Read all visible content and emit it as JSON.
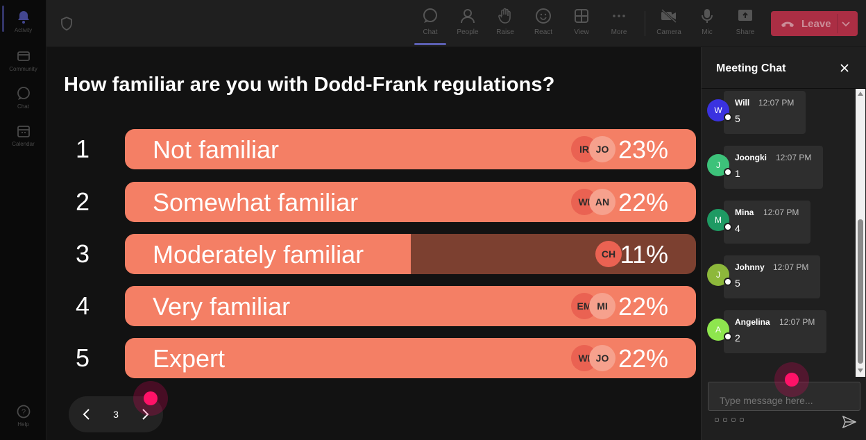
{
  "rail": {
    "items": [
      {
        "label": "Activity"
      },
      {
        "label": "Community"
      },
      {
        "label": "Chat"
      },
      {
        "label": "Calendar"
      },
      {
        "label": "Help"
      }
    ]
  },
  "toolbar": {
    "chat": "Chat",
    "people": "People",
    "raise": "Raise",
    "react": "React",
    "view": "View",
    "more": "More",
    "camera": "Camera",
    "mic": "Mic",
    "share": "Share",
    "leave": "Leave"
  },
  "poll": {
    "question": "How familiar are you with Dodd-Frank regulations?",
    "options": [
      {
        "num": "1",
        "label": "Not familiar",
        "percent": "23%",
        "fill": 1.0,
        "avatars": [
          "IR",
          "JO"
        ]
      },
      {
        "num": "2",
        "label": "Somewhat familiar",
        "percent": "22%",
        "fill": 1.0,
        "avatars": [
          "WI",
          "AN"
        ]
      },
      {
        "num": "3",
        "label": "Moderately familiar",
        "percent": "11%",
        "fill": 0.5,
        "avatars": [
          "CH"
        ]
      },
      {
        "num": "4",
        "label": "Very familiar",
        "percent": "22%",
        "fill": 1.0,
        "avatars": [
          "EM",
          "MI"
        ]
      },
      {
        "num": "5",
        "label": "Expert",
        "percent": "22%",
        "fill": 1.0,
        "avatars": [
          "WI",
          "JO"
        ]
      }
    ],
    "page": "3"
  },
  "chat": {
    "title": "Meeting Chat",
    "messages": [
      {
        "initial": "W",
        "name": "Will",
        "time": "12:07 PM",
        "text": "5",
        "color": "#3a32e0"
      },
      {
        "initial": "J",
        "name": "Joongki",
        "time": "12:07 PM",
        "text": "1",
        "color": "#3dc27a"
      },
      {
        "initial": "M",
        "name": "Mina",
        "time": "12:07 PM",
        "text": "4",
        "color": "#1e9a63"
      },
      {
        "initial": "J",
        "name": "Johnny",
        "time": "12:07 PM",
        "text": "5",
        "color": "#8db83b"
      },
      {
        "initial": "A",
        "name": "Angelina",
        "time": "12:07 PM",
        "text": "2",
        "color": "#8ee64e"
      }
    ],
    "input_placeholder": "Type message here..."
  }
}
